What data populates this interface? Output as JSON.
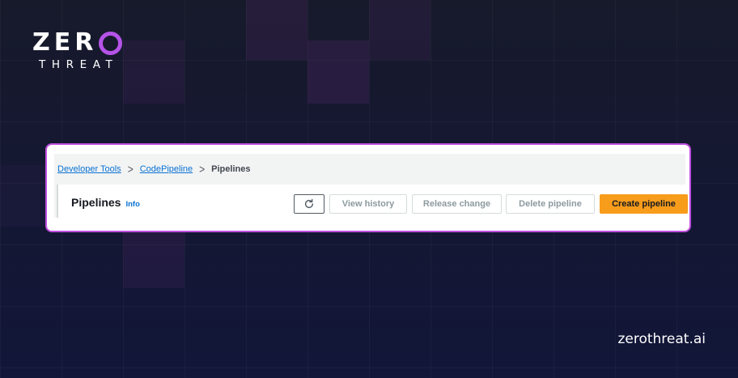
{
  "brand": {
    "logo_word": "ZERO",
    "logo_sub": "THREAT",
    "domain": "zerothreat.ai",
    "accent_color": "#b553e8"
  },
  "breadcrumb": {
    "items": [
      "Developer Tools",
      "CodePipeline"
    ],
    "current": "Pipelines",
    "separator": ">"
  },
  "header": {
    "title": "Pipelines",
    "info_link": "Info"
  },
  "actions": {
    "refresh_icon": "refresh-icon",
    "view_history": "View history",
    "release_change": "Release change",
    "delete_pipeline": "Delete pipeline",
    "create_pipeline": "Create pipeline",
    "primary_color": "#f89c1c"
  }
}
